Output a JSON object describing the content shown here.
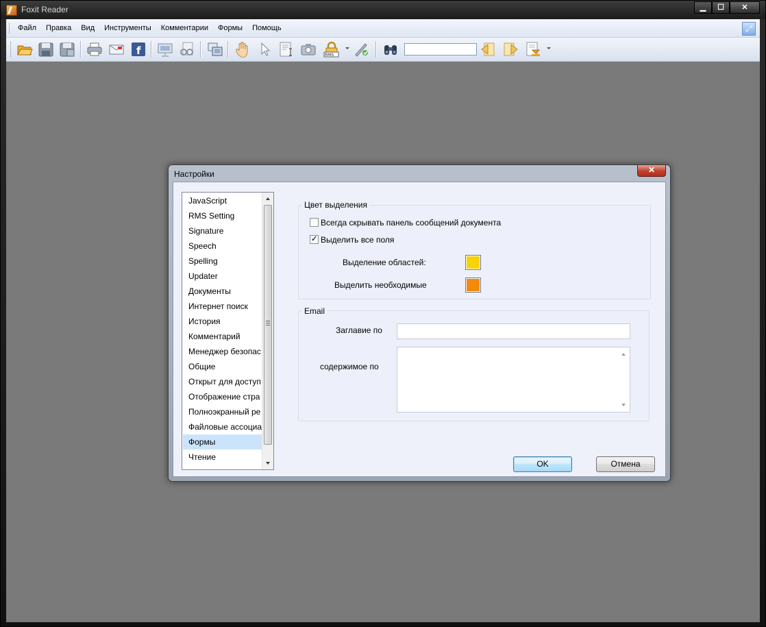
{
  "window": {
    "title": "Foxit Reader",
    "minimize": "▁",
    "maximize": "☐",
    "close": "✕"
  },
  "menu": [
    {
      "label": "Файл"
    },
    {
      "label": "Правка"
    },
    {
      "label": "Вид"
    },
    {
      "label": "Инструменты"
    },
    {
      "label": "Комментарии"
    },
    {
      "label": "Формы"
    },
    {
      "label": "Помощь"
    }
  ],
  "toolbar": {
    "icons": [
      "open-folder-icon",
      "save-icon",
      "save-as-icon",
      "print-icon",
      "email-icon",
      "facebook-icon",
      "presentation-icon",
      "find-glasses-icon",
      "snapshot-layout-icon",
      "hand-tool-icon",
      "select-cursor-icon",
      "select-text-icon",
      "camera-snapshot-icon",
      "rms-lock-icon",
      "sign-icon",
      "binoculars-icon",
      "find-previous-icon",
      "find-next-icon",
      "form-reset-icon"
    ],
    "find_value": ""
  },
  "dialog": {
    "title": "Настройки",
    "close": "✕",
    "categories": [
      {
        "label": "JavaScript"
      },
      {
        "label": "RMS Setting"
      },
      {
        "label": "Signature"
      },
      {
        "label": "Speech"
      },
      {
        "label": "Spelling"
      },
      {
        "label": "Updater"
      },
      {
        "label": "Документы"
      },
      {
        "label": "Интернет поиск"
      },
      {
        "label": "История"
      },
      {
        "label": "Комментарий"
      },
      {
        "label": "Менеджер безопас"
      },
      {
        "label": "Общие"
      },
      {
        "label": "Открыт для доступ"
      },
      {
        "label": "Отображение стра"
      },
      {
        "label": "Полноэкранный ре"
      },
      {
        "label": "Файловые ассоциа"
      },
      {
        "label": "Формы"
      },
      {
        "label": "Чтение"
      }
    ],
    "selected_category": "Формы",
    "highlight": {
      "group_label": "Цвет выделения",
      "hide_messages_label": "Всегда скрывать панель сообщений документа",
      "hide_messages_checked": false,
      "highlight_all_label": "Выделить все поля",
      "highlight_all_checked": true,
      "area_label": "Выделение областей:",
      "area_color": "#f7d40a",
      "required_label": "Выделить необходимые",
      "required_color": "#f28a0c"
    },
    "email": {
      "group_label": "Email",
      "subject_label": "Заглавие по",
      "subject_value": "",
      "body_label": "содержимое по",
      "body_value": ""
    },
    "ok_label": "OK",
    "cancel_label": "Отмена"
  }
}
